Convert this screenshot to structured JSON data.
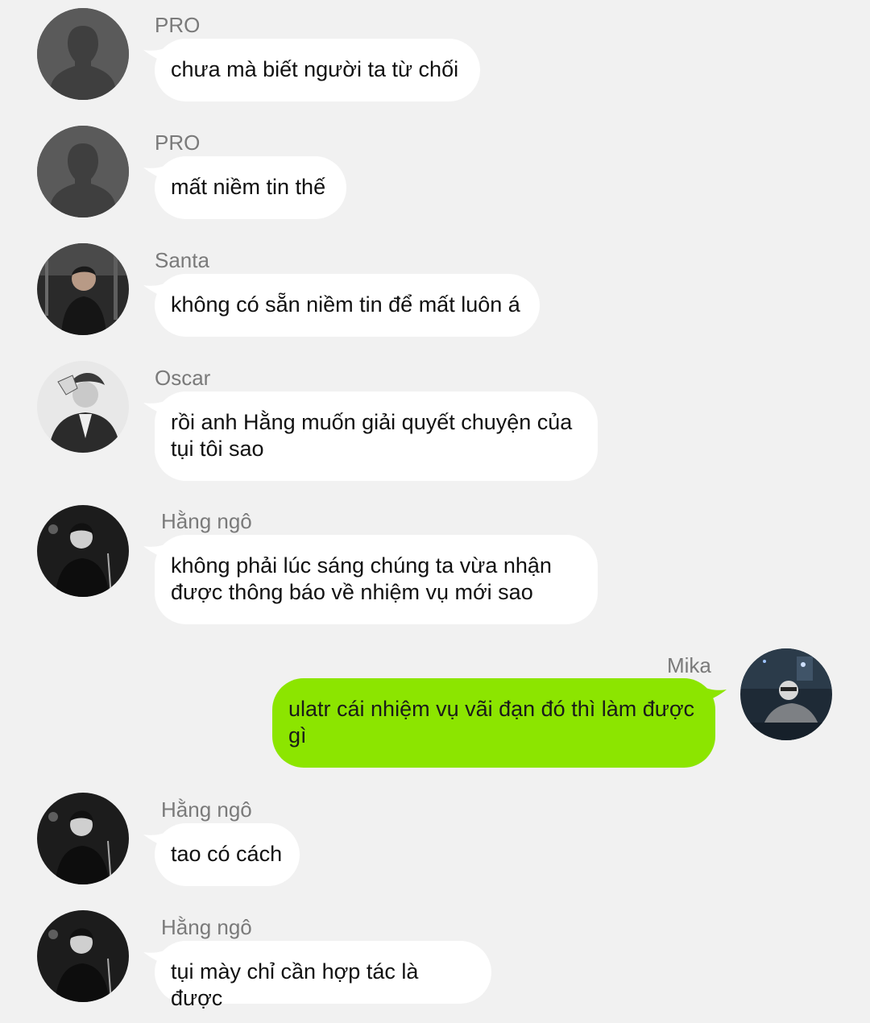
{
  "messages": [
    {
      "sender": "PRO",
      "text": "chưa mà biết người ta từ chối",
      "direction": "in",
      "avatar": "silhouette-icon"
    },
    {
      "sender": "PRO",
      "text": "mất niềm tin thế",
      "direction": "in",
      "avatar": "silhouette-icon"
    },
    {
      "sender": "Santa",
      "text": "không có sẵn niềm tin để mất luôn á",
      "direction": "in",
      "avatar": "photo-dark"
    },
    {
      "sender": "Oscar",
      "text": "rồi anh Hằng muốn giải quyết chuyện của\ntụi tôi sao",
      "direction": "in",
      "avatar": "photo-bw"
    },
    {
      "sender": "Hằng ngô",
      "text": "không phải lúc sáng chúng ta vừa nhận\nđược thông báo về nhiệm vụ mới sao",
      "direction": "in",
      "avatar": "photo-bw-stage"
    },
    {
      "sender": "Mika",
      "text": "ulatr cái nhiệm vụ vãi đạn đó thì làm được\ngì",
      "direction": "out",
      "avatar": "photo-dj"
    },
    {
      "sender": "Hằng ngô",
      "text": "tao có cách",
      "direction": "in",
      "avatar": "photo-bw-stage"
    },
    {
      "sender": "Hằng ngô",
      "text": "tụi mày chỉ cần hợp tác là được",
      "direction": "in",
      "avatar": "photo-bw-stage"
    }
  ],
  "colors": {
    "background": "#f1f1f1",
    "incoming_bubble": "#ffffff",
    "outgoing_bubble": "#8ce500",
    "sender_name": "#7a7a7a"
  }
}
